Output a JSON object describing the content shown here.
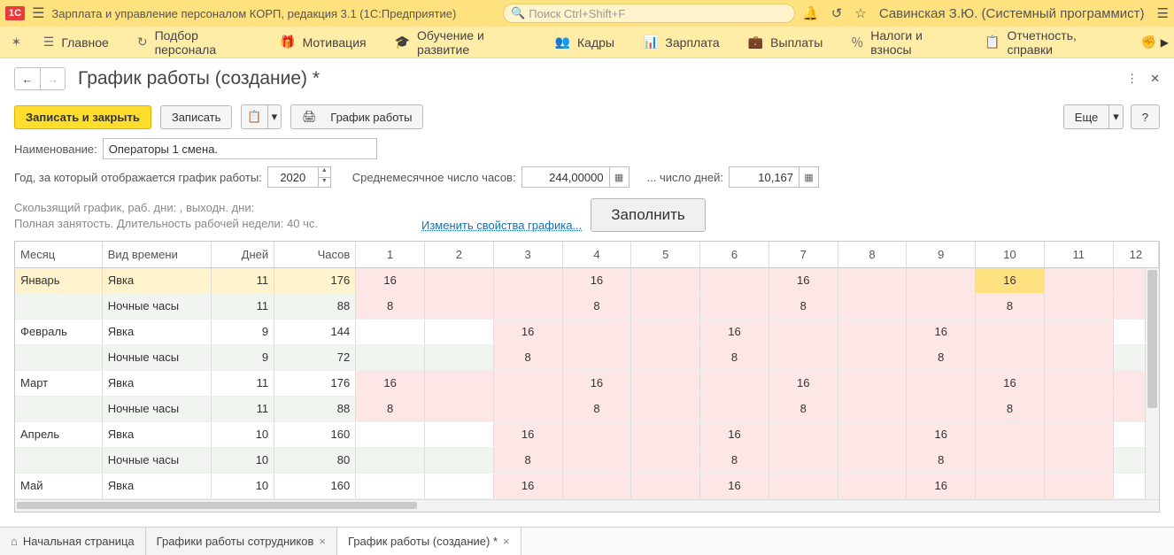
{
  "titlebar": {
    "logo": "1C",
    "title": "Зарплата и управление персоналом КОРП, редакция 3.1  (1С:Предприятие)",
    "search_placeholder": "Поиск Ctrl+Shift+F",
    "user": "Савинская З.Ю. (Системный программист)"
  },
  "menu": [
    {
      "icon": "☰",
      "label": "Главное"
    },
    {
      "icon": "↻",
      "label": "Подбор персонала"
    },
    {
      "icon": "🎁",
      "label": "Мотивация"
    },
    {
      "icon": "🎓",
      "label": "Обучение и развитие"
    },
    {
      "icon": "👥",
      "label": "Кадры"
    },
    {
      "icon": "📊",
      "label": "Зарплата"
    },
    {
      "icon": "💼",
      "label": "Выплаты"
    },
    {
      "icon": "％",
      "label": "Налоги и взносы"
    },
    {
      "icon": "📋",
      "label": "Отчетность, справки"
    },
    {
      "icon": "✊",
      "label": ""
    }
  ],
  "page": {
    "title": "График работы (создание) *"
  },
  "toolbar": {
    "save_close": "Записать и закрыть",
    "save": "Записать",
    "schedule": "График работы",
    "more": "Еще",
    "help": "?"
  },
  "form": {
    "name_label": "Наименование:",
    "name_value": "Операторы 1 смена.",
    "year_label": "Год, за который отображается график работы:",
    "year_value": "2020",
    "avg_hours_label": "Среднемесячное число часов:",
    "avg_hours_value": "244,00000",
    "avg_days_label": "... число дней:",
    "avg_days_value": "10,167"
  },
  "hints": {
    "line1": "Скользящий график, раб. дни: , выходн. дни:",
    "line2": "Полная занятость. Длительность рабочей недели: 40 чс.",
    "change_link": "Изменить свойства графика...",
    "fill_button": "Заполнить"
  },
  "table": {
    "headers": {
      "month": "Месяц",
      "type": "Вид времени",
      "days": "Дней",
      "hours": "Часов"
    },
    "day_cols": [
      "1",
      "2",
      "3",
      "4",
      "5",
      "6",
      "7",
      "8",
      "9",
      "10",
      "11",
      "12"
    ],
    "rows": [
      {
        "month": "Январь",
        "type": "Явка",
        "days": "11",
        "hours": "176",
        "sel": true,
        "cells": {
          "1": "16",
          "4": "16",
          "7": "16",
          "10": "16"
        }
      },
      {
        "month": "",
        "type": "Ночные часы",
        "days": "11",
        "hours": "88",
        "alt": true,
        "cells": {
          "1": "8",
          "4": "8",
          "7": "8",
          "10": "8"
        }
      },
      {
        "month": "Февраль",
        "type": "Явка",
        "days": "9",
        "hours": "144",
        "cells": {
          "3": "16",
          "6": "16",
          "9": "16"
        }
      },
      {
        "month": "",
        "type": "Ночные часы",
        "days": "9",
        "hours": "72",
        "alt": true,
        "cells": {
          "3": "8",
          "6": "8",
          "9": "8"
        }
      },
      {
        "month": "Март",
        "type": "Явка",
        "days": "11",
        "hours": "176",
        "cells": {
          "1": "16",
          "4": "16",
          "7": "16",
          "10": "16"
        }
      },
      {
        "month": "",
        "type": "Ночные часы",
        "days": "11",
        "hours": "88",
        "alt": true,
        "cells": {
          "1": "8",
          "4": "8",
          "7": "8",
          "10": "8"
        }
      },
      {
        "month": "Апрель",
        "type": "Явка",
        "days": "10",
        "hours": "160",
        "cells": {
          "3": "16",
          "6": "16",
          "9": "16"
        }
      },
      {
        "month": "",
        "type": "Ночные часы",
        "days": "10",
        "hours": "80",
        "alt": true,
        "cells": {
          "3": "8",
          "6": "8",
          "9": "8"
        }
      },
      {
        "month": "Май",
        "type": "Явка",
        "days": "10",
        "hours": "160",
        "cells": {
          "3": "16",
          "6": "16",
          "9": "16"
        }
      }
    ]
  },
  "tabs": [
    {
      "label": "Начальная страница",
      "home": true
    },
    {
      "label": "Графики работы сотрудников",
      "close": true
    },
    {
      "label": "График работы (создание) *",
      "close": true,
      "active": true
    }
  ]
}
